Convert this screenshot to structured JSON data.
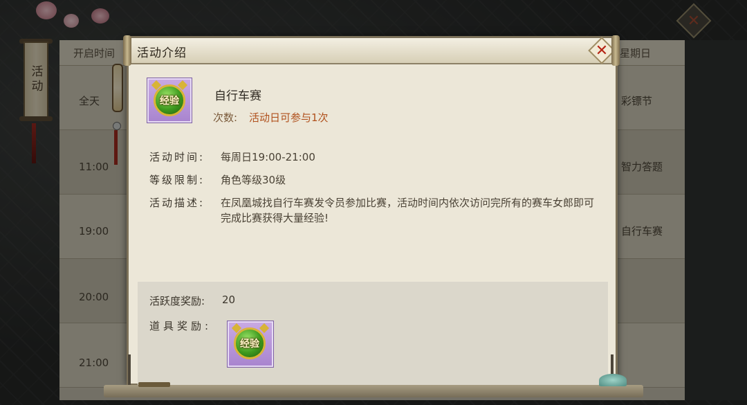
{
  "background": {
    "left_tab": "活动",
    "schedule": {
      "header_left": "开启时间",
      "header_right": "星期日",
      "rows": [
        {
          "time": "全天",
          "activity": "彩镖节"
        },
        {
          "time": "11:00",
          "activity": "智力答题"
        },
        {
          "time": "19:00",
          "activity": "自行车赛"
        },
        {
          "time": "20:00",
          "activity": ""
        },
        {
          "time": "21:00",
          "activity": ""
        }
      ]
    }
  },
  "dialog": {
    "title": "活动介绍",
    "close_icon": "close-x",
    "activity": {
      "icon_text": "经验",
      "name": "自行车赛",
      "times_label": "次数:",
      "times_value": "活动日可参与1次"
    },
    "info": {
      "time_label": "活动时间:",
      "time_value": "每周日19:00-21:00",
      "level_label": "等级限制:",
      "level_value": "角色等级30级",
      "desc_label": "活动描述:",
      "desc_value": "在凤凰城找自行车赛发令员参加比赛，活动时间内依次访问完所有的赛车女郎即可完成比赛获得大量经验!"
    },
    "reward": {
      "activity_label": "活跃度奖励:",
      "activity_value": "20",
      "item_label": "道具奖励:",
      "item_icon_text": "经验"
    }
  },
  "colors": {
    "dialog_bg": "#ece7d8",
    "accent_orange": "#b0501c",
    "close_red": "#b52414",
    "item_purple": "#a985cf"
  }
}
